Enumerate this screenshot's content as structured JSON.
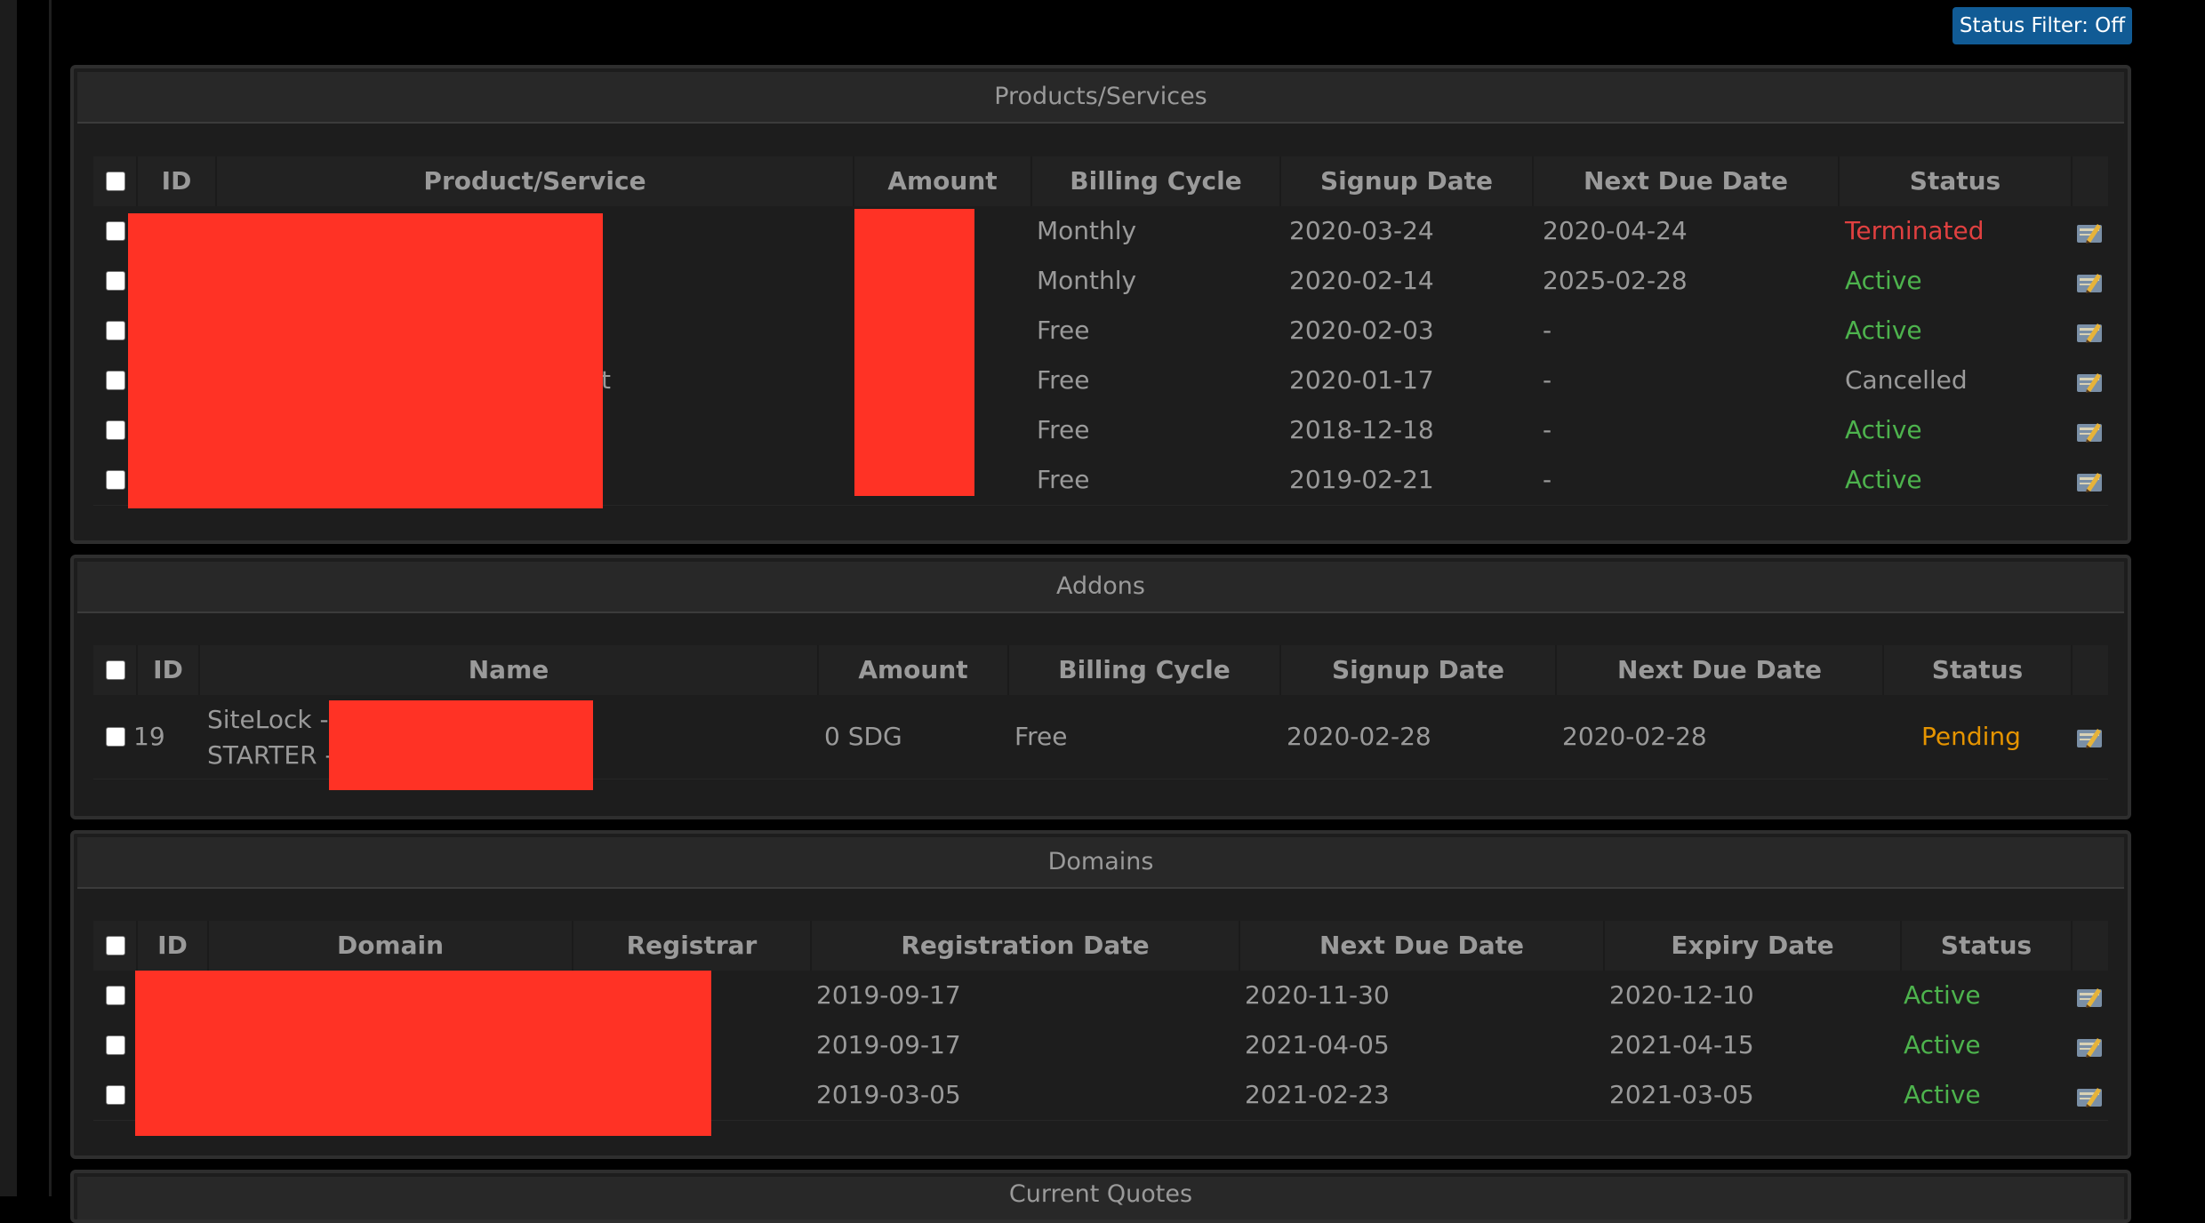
{
  "status_filter": "Status Filter: Off",
  "products": {
    "title": "Products/Services",
    "headers": {
      "id": "ID",
      "product": "Product/Service",
      "amount": "Amount",
      "billing": "Billing Cycle",
      "signup": "Signup Date",
      "next_due": "Next Due Date",
      "status": "Status"
    },
    "rows": [
      {
        "billing": "Monthly",
        "signup": "2020-03-24",
        "next_due": "2020-04-24",
        "status": "Terminated"
      },
      {
        "billing": "Monthly",
        "signup": "2020-02-14",
        "next_due": "2025-02-28",
        "status": "Active"
      },
      {
        "billing": "Free",
        "signup": "2020-02-03",
        "next_due": "-",
        "status": "Active"
      },
      {
        "billing": "Free",
        "signup": "2020-01-17",
        "next_due": "-",
        "status": "Cancelled"
      },
      {
        "billing": "Free",
        "signup": "2018-12-18",
        "next_due": "-",
        "status": "Active"
      },
      {
        "billing": "Free",
        "signup": "2019-02-21",
        "next_due": "-",
        "status": "Active"
      }
    ],
    "visible_fragment": "t"
  },
  "addons": {
    "title": "Addons",
    "headers": {
      "id": "ID",
      "name": "Name",
      "amount": "Amount",
      "billing": "Billing Cycle",
      "signup": "Signup Date",
      "next_due": "Next Due Date",
      "status": "Status"
    },
    "rows": [
      {
        "id": "19",
        "name_line1": "SiteLock -",
        "name_line2": "STARTER -",
        "amount": "0 SDG",
        "billing": "Free",
        "signup": "2020-02-28",
        "next_due": "2020-02-28",
        "status": "Pending"
      }
    ]
  },
  "domains": {
    "title": "Domains",
    "headers": {
      "id": "ID",
      "domain": "Domain",
      "registrar": "Registrar",
      "reg_date": "Registration Date",
      "next_due": "Next Due Date",
      "expiry": "Expiry Date",
      "status": "Status"
    },
    "rows": [
      {
        "reg_date": "2019-09-17",
        "next_due": "2020-11-30",
        "expiry": "2020-12-10",
        "status": "Active"
      },
      {
        "reg_date": "2019-09-17",
        "next_due": "2021-04-05",
        "expiry": "2021-04-15",
        "status": "Active"
      },
      {
        "reg_date": "2019-03-05",
        "next_due": "2021-02-23",
        "expiry": "2021-03-05",
        "status": "Active"
      }
    ]
  },
  "quotes": {
    "title": "Current Quotes"
  },
  "icons": {
    "edit": "edit-invoice-icon"
  },
  "colors": {
    "active": "#4db34d",
    "terminated": "#e04040",
    "pending": "#e59400",
    "filter_button": "#115b95",
    "redaction": "#ff3225"
  }
}
